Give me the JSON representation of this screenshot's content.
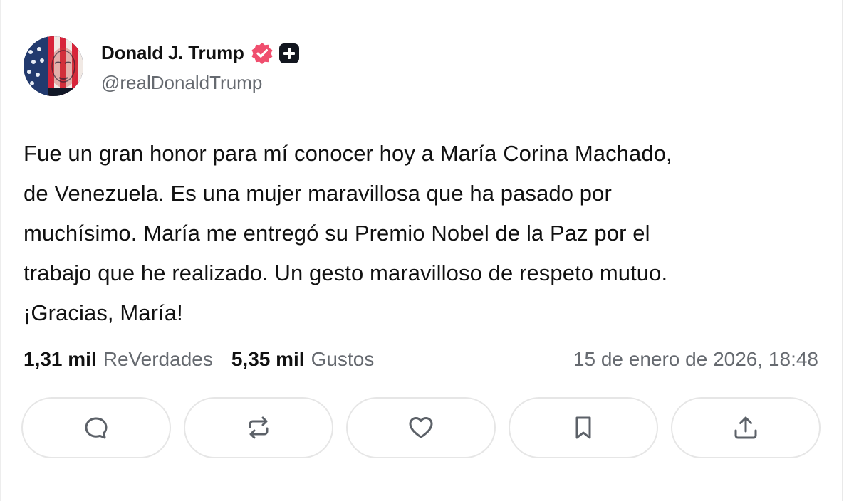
{
  "post": {
    "author": {
      "name": "Donald J. Trump",
      "handle": "@realDonaldTrump",
      "avatar": "american-flag-portrait",
      "verified_color": "#f04e6e"
    },
    "text": [
      "Fue un gran honor para mí conocer hoy a María Corina Machado,",
      "de Venezuela. Es una mujer maravillosa que ha pasado por",
      "muchísimo. María me entregó su Premio Nobel de la Paz por el",
      "trabajo que he realizado. Un gesto maravilloso de respeto mutuo.",
      "¡Gracias, María!"
    ],
    "stats": {
      "reposts_count": "1,31 mil",
      "reposts_label": "ReVerdades",
      "likes_count": "5,35 mil",
      "likes_label": "Gustos",
      "timestamp": "15 de enero de 2026, 18:48"
    },
    "actions": [
      "reply-icon",
      "repost-icon",
      "like-icon",
      "bookmark-icon",
      "share-icon"
    ]
  }
}
